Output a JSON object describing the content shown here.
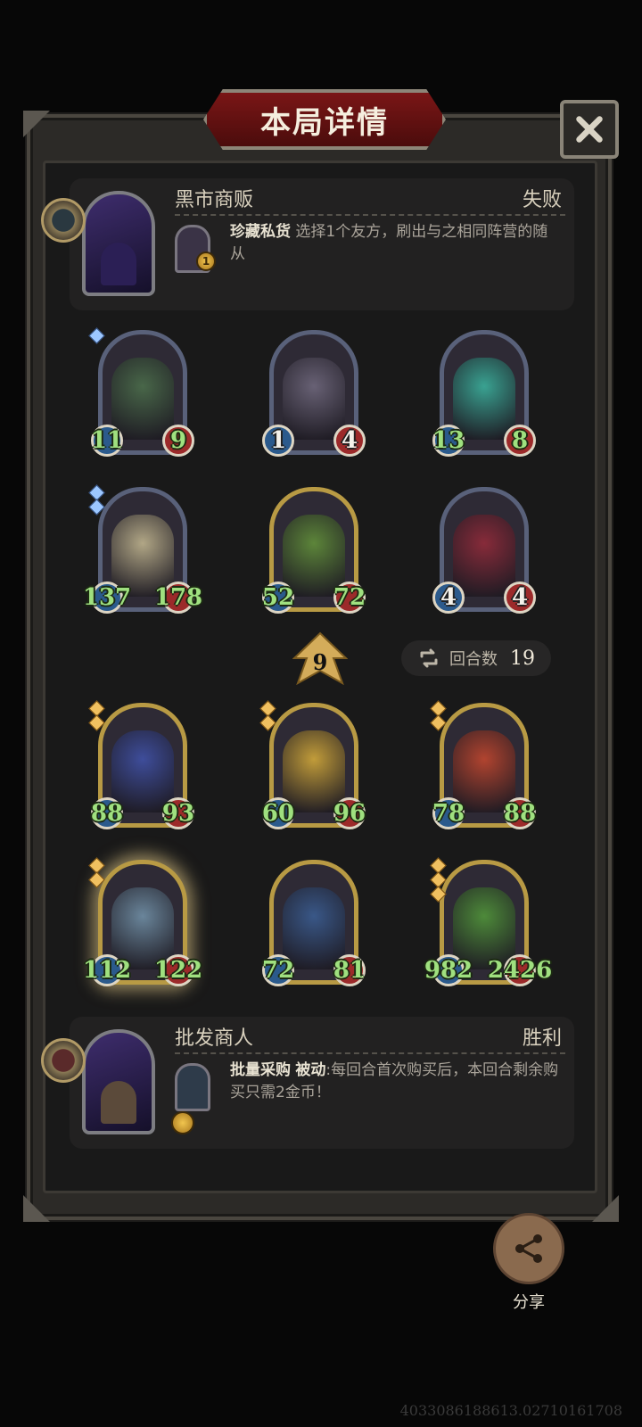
{
  "dialog": {
    "title": "本局详情",
    "close_icon": "close-icon"
  },
  "opponent": {
    "name": "黑市商贩",
    "result": "失败",
    "skill": {
      "name": "珍藏私货",
      "description": "选择1个友方，刷出与之相同阵营的随从",
      "cost": "1"
    }
  },
  "opponent_board": [
    {
      "atk": "11",
      "hp": "9",
      "frame": "silver",
      "gems": 1,
      "color": "#4a6a4a",
      "stat_style": "green"
    },
    {
      "atk": "1",
      "hp": "4",
      "frame": "silver",
      "gems": 0,
      "color": "#6b6478",
      "stat_style": "white"
    },
    {
      "atk": "13",
      "hp": "8",
      "frame": "silver",
      "gems": 0,
      "color": "#3aa896",
      "stat_style": "green"
    },
    {
      "atk": "137",
      "hp": "178",
      "frame": "silver",
      "gems": 2,
      "color": "#b8ad8a",
      "stat_style": "green"
    },
    {
      "atk": "52",
      "hp": "72",
      "frame": "gold",
      "gems": 0,
      "color": "#5f8a3a",
      "stat_style": "green"
    },
    {
      "atk": "4",
      "hp": "4",
      "frame": "silver",
      "gems": 0,
      "color": "#8c2b3a",
      "stat_style": "white"
    }
  ],
  "tavern_level": "9",
  "rounds": {
    "label": "回合数",
    "value": "19"
  },
  "player_board": [
    {
      "atk": "88",
      "hp": "93",
      "frame": "gold",
      "gems": 2,
      "color": "#3f4fa0",
      "stat_style": "green"
    },
    {
      "atk": "60",
      "hp": "96",
      "frame": "gold",
      "gems": 2,
      "color": "#c9a23a",
      "stat_style": "green"
    },
    {
      "atk": "78",
      "hp": "88",
      "frame": "gold",
      "gems": 2,
      "color": "#b8452f",
      "stat_style": "green"
    },
    {
      "atk": "112",
      "hp": "122",
      "frame": "gold",
      "gems": 2,
      "color": "#6d8aa0",
      "stat_style": "green",
      "glow": true
    },
    {
      "atk": "72",
      "hp": "81",
      "frame": "gold",
      "gems": 0,
      "color": "#3a5a8c",
      "stat_style": "green"
    },
    {
      "atk": "982",
      "hp": "2426",
      "frame": "gold",
      "gems": 3,
      "color": "#4f8f3a",
      "stat_style": "green"
    }
  ],
  "player": {
    "name": "批发商人",
    "result": "胜利",
    "skill": {
      "name": "批量采购",
      "tag": "被动",
      "description": ":每回合首次购买后，本回合剩余购买只需2金币！"
    }
  },
  "share": {
    "label": "分享"
  },
  "build_info": "4033086188613.02710161708",
  "colors": {
    "title_red": "#6b1111",
    "panel": "#222121",
    "frame": "#2c2a27",
    "stat_green": "#9fe07f"
  }
}
